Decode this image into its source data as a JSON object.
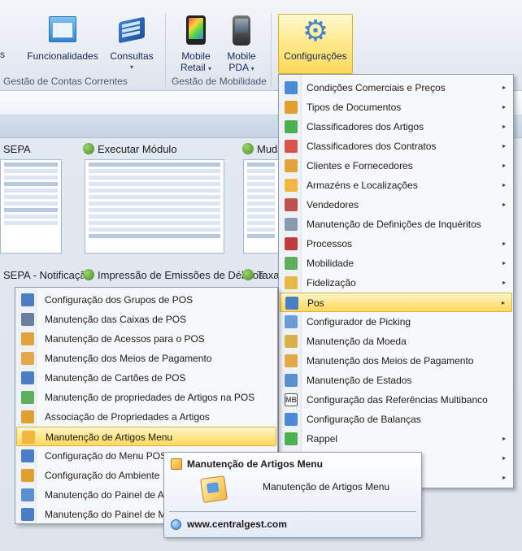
{
  "ribbon": {
    "partial_label": "s",
    "buttons": [
      {
        "name": "funcionalidades",
        "label": "Funcionalidades",
        "icon": "window-stack-icon"
      },
      {
        "name": "consultas",
        "label": "Consultas",
        "icon": "book-icon"
      },
      {
        "name": "mobile-retail",
        "label_line1": "Mobile",
        "label_line2": "Retail",
        "icon": "tablet-icon"
      },
      {
        "name": "mobile-pda",
        "label_line1": "Mobile",
        "label_line2": "PDA",
        "icon": "pda-icon"
      },
      {
        "name": "configuracoes",
        "label": "Configurações",
        "icon": "gears-icon",
        "selected": true
      }
    ],
    "groups": {
      "contas": "Gestão de Contas Correntes",
      "mobilidade": "Gestão de Mobilidade"
    },
    "caret": "▾"
  },
  "tiles": {
    "sepa": "SEPA",
    "executar": "Executar Módulo",
    "muda": "Muda",
    "sepa_notif": "SEPA - Notificação",
    "impressao": "Impressão de Emissões de Débitos",
    "taxa": "Taxa"
  },
  "main_menu": {
    "items": [
      {
        "label": "Condições Comerciais e Preços",
        "submenu": true,
        "icon": "conditions-icon",
        "color": "#4a8ad6"
      },
      {
        "label": "Tipos de Documentos",
        "submenu": true,
        "icon": "document-types-icon",
        "color": "#e0a030"
      },
      {
        "label": "Classificadores dos Artigos",
        "submenu": true,
        "icon": "classifier-icon",
        "color": "#4caf50"
      },
      {
        "label": "Classificadores dos Contratos",
        "submenu": true,
        "icon": "contract-icon",
        "color": "#d9534f"
      },
      {
        "label": "Clientes e Fornecedores",
        "submenu": true,
        "icon": "users-icon",
        "color": "#e3a23c"
      },
      {
        "label": "Armazéns e Localizações",
        "submenu": true,
        "icon": "warehouse-icon",
        "color": "#f0b840"
      },
      {
        "label": "Vendedores",
        "submenu": true,
        "icon": "seller-icon",
        "color": "#c0504d"
      },
      {
        "label": "Manutenção de Definições de Inquéritos",
        "submenu": false,
        "icon": "survey-icon",
        "color": "#8c99ad"
      },
      {
        "label": "Processos",
        "submenu": true,
        "icon": "process-icon",
        "color": "#c03b3b"
      },
      {
        "label": "Mobilidade",
        "submenu": true,
        "icon": "mobility-icon",
        "color": "#5fae5f"
      },
      {
        "label": "Fidelização",
        "submenu": true,
        "icon": "loyalty-icon",
        "color": "#e6b84a"
      },
      {
        "label": "Pos",
        "submenu": true,
        "icon": "pos-icon",
        "color": "#4a7fc4",
        "highlighted": true
      },
      {
        "label": "Configurador de Picking",
        "submenu": false,
        "icon": "picking-icon",
        "color": "#6b9bd6"
      },
      {
        "label": "Manutenção da Moeda",
        "submenu": false,
        "icon": "coin-icon",
        "color": "#d8b04a"
      },
      {
        "label": "Manutenção dos Meios de Pagamento",
        "submenu": false,
        "icon": "payment-icon",
        "color": "#e2a84a"
      },
      {
        "label": "Manutenção de Estados",
        "submenu": false,
        "icon": "states-icon",
        "color": "#5a8fd0"
      },
      {
        "label": "Configuração das Referências Multibanco",
        "submenu": false,
        "icon": "multibanco-icon",
        "color": "#555555",
        "glyph": "MB"
      },
      {
        "label": "Configuração de Balanças",
        "submenu": false,
        "icon": "scale-icon",
        "color": "#4a8ad6"
      },
      {
        "label": "Rappel",
        "submenu": true,
        "icon": "rappel-icon",
        "color": "#4caf50"
      }
    ],
    "trailing_arrow_rows": 2,
    "arrow": "▸"
  },
  "sub_menu": {
    "items": [
      {
        "label": "Configuração dos Grupos de POS",
        "icon": "pos-group-icon",
        "color": "#4a7fc4"
      },
      {
        "label": "Manutenção das Caixas de POS",
        "icon": "cash-register-icon",
        "color": "#6a7f9c"
      },
      {
        "label": "Manutenção de Acessos para o POS",
        "icon": "access-icon",
        "color": "#e3a23c"
      },
      {
        "label": "Manutenção dos Meios de Pagamento",
        "icon": "payment-icon",
        "color": "#e2a84a"
      },
      {
        "label": "Manutenção de Cartões de POS",
        "icon": "card-icon",
        "color": "#4a7fc4"
      },
      {
        "label": "Manutenção de propriedades de Artigos na POS",
        "icon": "properties-icon",
        "color": "#5fae5f"
      },
      {
        "label": "Associação de Propriedades a Artigos",
        "icon": "association-icon",
        "color": "#e0a030"
      },
      {
        "label": "Manutenção de Artigos Menu",
        "icon": "menu-items-icon",
        "color": "#f0b840",
        "highlighted": true
      },
      {
        "label": "Configuração do Menu POS",
        "icon": "menu-config-icon",
        "color": "#4a7fc4"
      },
      {
        "label": "Configuração do Ambiente",
        "icon": "environment-icon",
        "color": "#e0a030"
      },
      {
        "label": "Manutenção do Painel de A",
        "icon": "panel-icon",
        "color": "#5a8fd0"
      },
      {
        "label": "Manutenção do Painel de M",
        "icon": "panel-icon",
        "color": "#4a7fc4"
      }
    ]
  },
  "tooltip": {
    "title": "Manutenção de Artigos Menu",
    "body": "Manutenção de Artigos Menu",
    "footer": "www.centralgest.com"
  }
}
